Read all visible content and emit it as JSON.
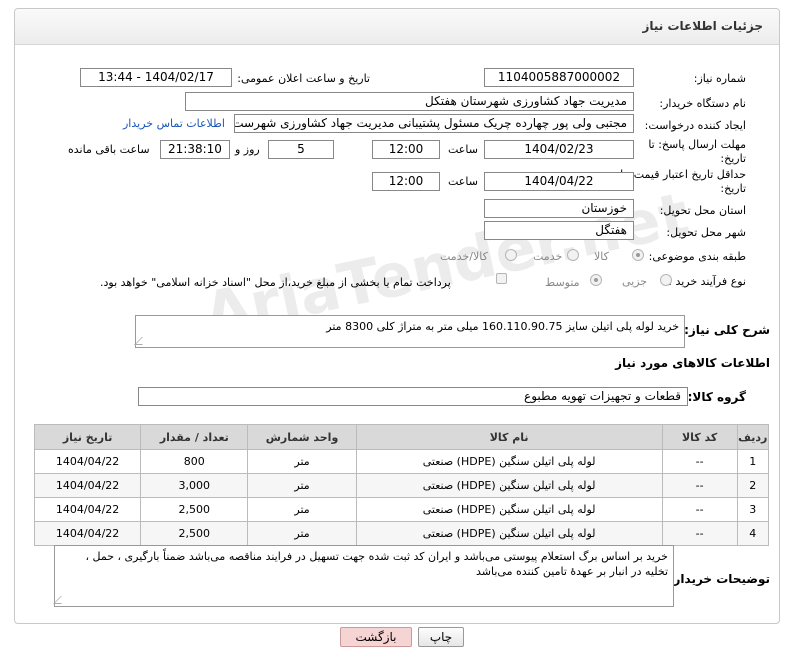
{
  "header": {
    "title": "جزئیات اطلاعات نیاز"
  },
  "fields": {
    "need_number_label": "شماره نیاز:",
    "need_number": "1104005887000002",
    "announce_label": "تاریخ و ساعت اعلان عمومی:",
    "announce_value": "1404/02/17 - 13:44",
    "buyer_org_label": "نام دستگاه خریدار:",
    "buyer_org": "مدیریت جهاد کشاورزی شهرستان هفتکل",
    "creator_label": "ایجاد کننده درخواست:",
    "creator": "مجتبی ولی پور چهارده چریک مسئول پشتیبانی مدیریت جهاد کشاورزی شهرست",
    "contact_link": "اطلاعات تماس خریدار",
    "reply_deadline_label": "مهلت ارسال پاسخ: تا تاریخ:",
    "reply_date": "1404/02/23",
    "time_label": "ساعت",
    "reply_time": "12:00",
    "days_value": "5",
    "days_label": "روز و",
    "remaining_time": "21:38:10",
    "remaining_label": "ساعت باقی مانده",
    "price_validity_label": "حداقل تاریخ اعتبار قیمت: تا تاریخ:",
    "price_date": "1404/04/22",
    "price_time": "12:00",
    "province_label": "استان محل تحویل:",
    "province": "خوزستان",
    "city_label": "شهر محل تحویل:",
    "city": "هفتگل",
    "category_label": "طبقه بندی موضوعی:",
    "category_options": [
      "کالا",
      "خدمت",
      "کالا/خدمت"
    ],
    "purchase_type_label": "نوع فرآیند خرید :",
    "purchase_options": [
      "جزیی",
      "متوسط"
    ],
    "payment_note": "پرداخت تمام یا بخشی از مبلغ خرید،از محل \"اسناد خزانه اسلامی\" خواهد بود.",
    "description_label": "شرح کلی نیاز:",
    "description": "خرید لوله پلی اتیلن سایز 160.110.90.75 میلی متر به متراژ کلی 8300 متر"
  },
  "goods": {
    "section_title": "اطلاعات کالاهای مورد نیاز",
    "group_label": "گروه کالا:",
    "group_value": "قطعات و تجهیزات تهویه مطبوع",
    "columns": [
      "ردیف",
      "کد کالا",
      "نام کالا",
      "واحد شمارش",
      "تعداد / مقدار",
      "تاریخ نیاز"
    ],
    "rows": [
      {
        "idx": "1",
        "code": "--",
        "name": "لوله پلی اتیلن سنگین (HDPE) صنعتی",
        "unit": "متر",
        "qty": "800",
        "date": "1404/04/22"
      },
      {
        "idx": "2",
        "code": "--",
        "name": "لوله پلی اتیلن سنگین (HDPE) صنعتی",
        "unit": "متر",
        "qty": "3,000",
        "date": "1404/04/22"
      },
      {
        "idx": "3",
        "code": "--",
        "name": "لوله پلی اتیلن سنگین (HDPE) صنعتی",
        "unit": "متر",
        "qty": "2,500",
        "date": "1404/04/22"
      },
      {
        "idx": "4",
        "code": "--",
        "name": "لوله پلی اتیلن سنگین (HDPE) صنعتی",
        "unit": "متر",
        "qty": "2,500",
        "date": "1404/04/22"
      }
    ]
  },
  "buyer_notes": {
    "label": "توضیحات خریدار:",
    "text": "خرید بر اساس برگ استعلام پیوستی می‌باشد و ایران کد ثبت شده جهت تسهیل در فرایند مناقصه می‌باشد ضمناً بارگیری ، حمل ، تخلیه در انبار بر عهدهٔ تامین کننده می‌باشد"
  },
  "buttons": {
    "print": "چاپ",
    "back": "بازگشت"
  },
  "watermark": "AriaTender.net"
}
